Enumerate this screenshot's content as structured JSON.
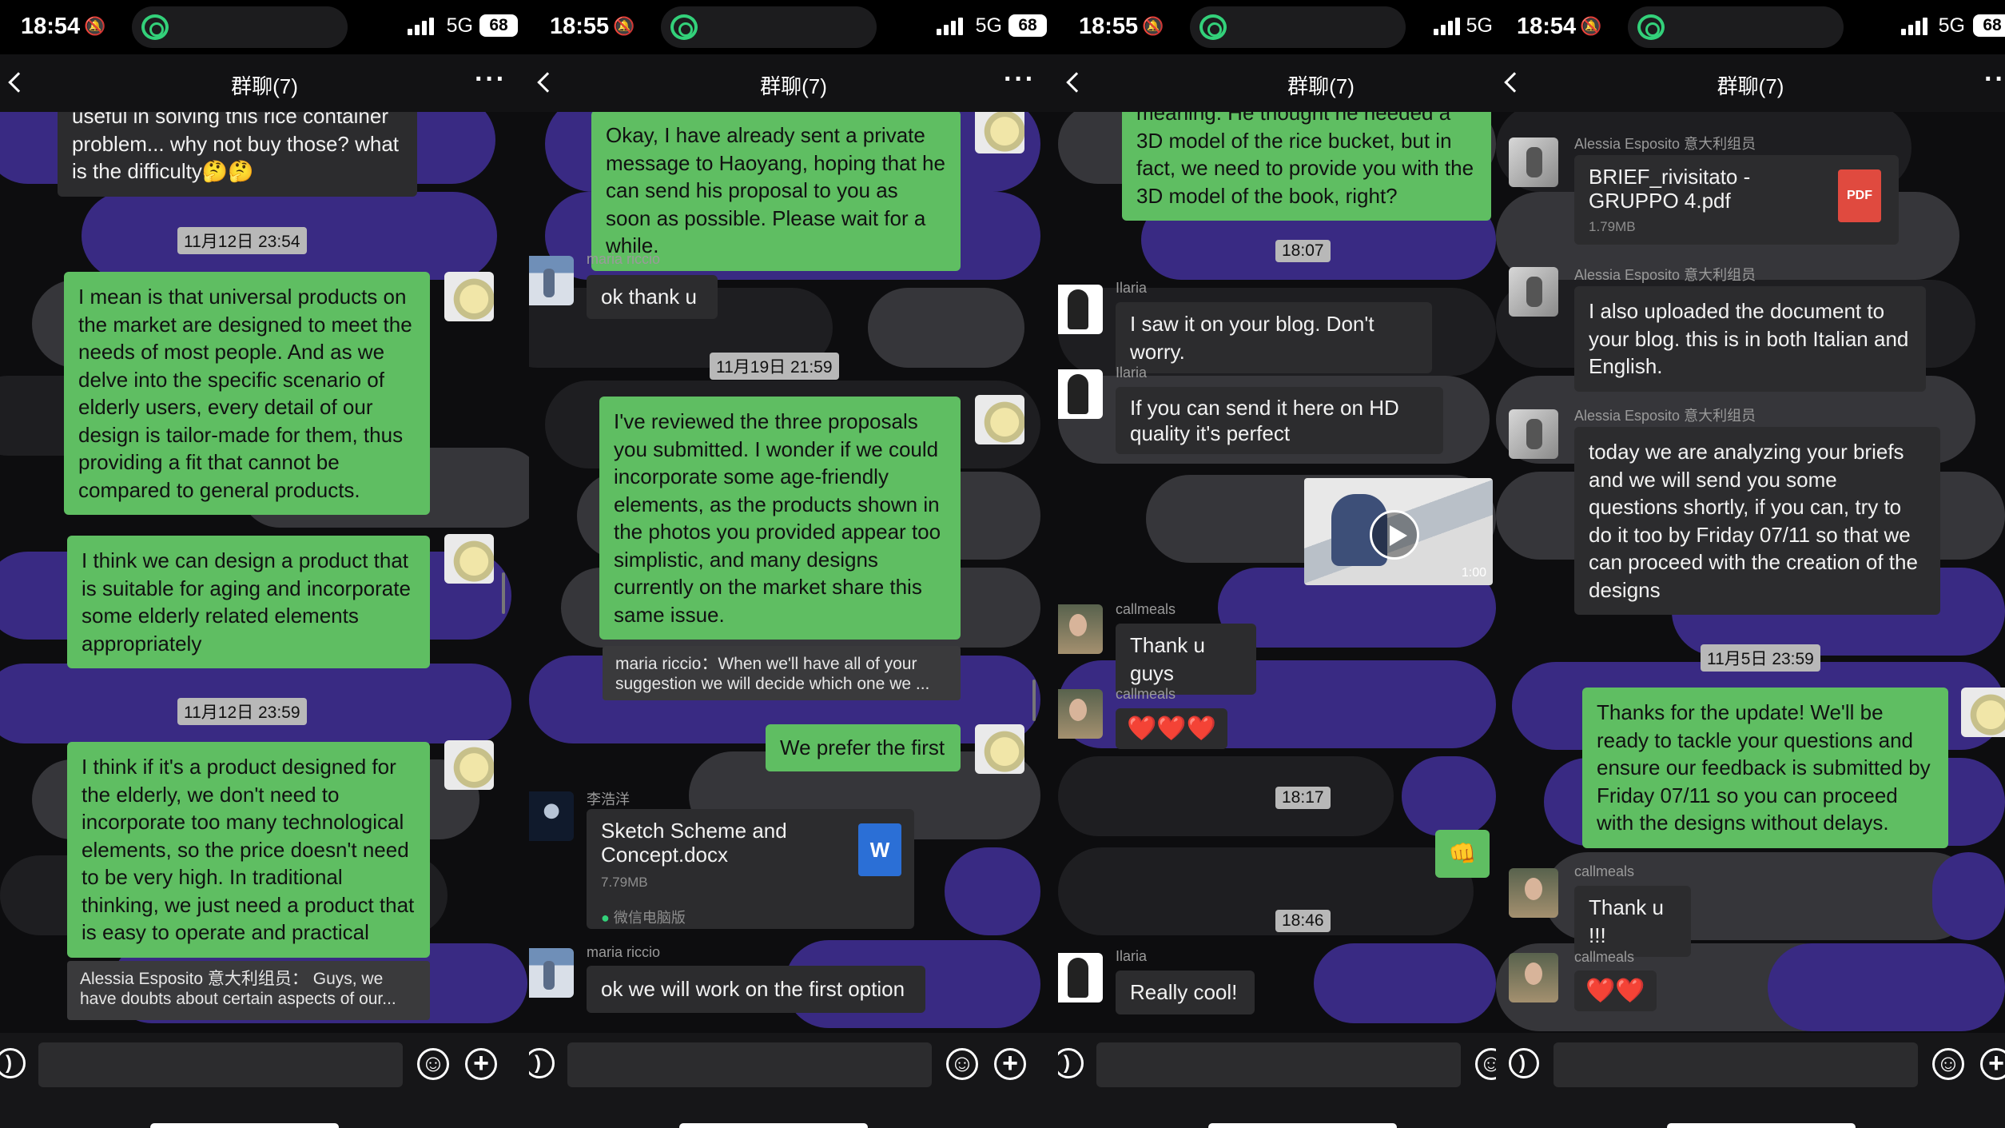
{
  "common": {
    "title": "群聊(7)",
    "network": "5G",
    "battery": "68"
  },
  "panel1": {
    "time": "18:54",
    "msgs": {
      "m0": "useful in solving this rice container problem... why not buy those? what is the difficulty🤔🤔",
      "ts1": "11月12日 23:54",
      "m1": "I mean is that universal products on the market are designed to meet the needs of most people. And as we delve into the specific scenario of elderly users, every detail of our design is tailor-made for them, thus providing a fit that cannot be compared to general products.",
      "m2": "I think we can design a product that is suitable for aging and incorporate some elderly related elements appropriately",
      "ts2": "11月12日 23:59",
      "m3": "I think if it's a product designed for the elderly, we don't need to incorporate too many technological elements, so the price doesn't need to be very high. In traditional thinking, we just need a product that is easy to operate and practical",
      "quote": "Alessia Esposito 意大利组员： Guys, we have doubts about certain aspects of our..."
    }
  },
  "panel2": {
    "time": "18:55",
    "msgs": {
      "m0": "Okay, I have already sent a private message to Haoyang, hoping that he can send his proposal to you as soon as possible. Please wait for a while.",
      "sender1": "maria riccio",
      "m1": "ok thank u",
      "ts1": "11月19日 21:59",
      "m2": "I've reviewed the three proposals you submitted. I wonder if we could incorporate some age-friendly elements, as the products shown in the photos you provided appear too simplistic, and many designs currently on the market share this same issue.",
      "quote": "maria riccio：When we'll have all of your suggestion we will decide which one we ...",
      "m3": "We prefer the first",
      "sender2": "李浩洋",
      "file_name": "Sketch Scheme and Concept.docx",
      "file_size": "7.79MB",
      "file_icon": "W",
      "file_source": "微信电脑版",
      "sender3": "maria riccio",
      "m4": "ok we will work on the first option"
    }
  },
  "panel3": {
    "time": "18:55",
    "msgs": {
      "m0": "meaning. He thought he needed a 3D model of the rice bucket, but in fact, we need to provide you with the 3D model of the book, right?",
      "ts1": "18:07",
      "sender1": "Ilaria",
      "m1": "I saw it on your blog. Don't worry.",
      "sender2": "Ilaria",
      "m2": "If you can send it here on HD quality it's perfect",
      "video_duration": "1:00",
      "sender3": "callmeals",
      "m3": "Thank u guys",
      "sender4": "callmeals",
      "m4": "❤️❤️❤️",
      "ts2": "18:17",
      "m5": "👊",
      "ts3": "18:46",
      "sender5": "Ilaria",
      "m6": "Really cool!"
    }
  },
  "panel4": {
    "time": "18:54",
    "msgs": {
      "sender1": "Alessia Esposito 意大利组员",
      "file_name": "BRIEF_rivisitato - GRUPPO 4.pdf",
      "file_size": "1.79MB",
      "file_icon": "PDF",
      "sender2": "Alessia Esposito 意大利组员",
      "m1": "I also uploaded the document to your blog. this is in both Italian and English.",
      "sender3": "Alessia Esposito 意大利组员",
      "m2": "today we are analyzing your briefs and we will send you some questions shortly, if you can, try to do it too by Friday 07/11 so that we can proceed with the creation of the designs",
      "ts1": "11月5日 23:59",
      "m3": "Thanks for the update! We'll be ready to tackle your questions and ensure our feedback is submitted by Friday 07/11 so you can proceed with the designs without delays.",
      "sender4": "callmeals",
      "m4": "Thank u !!!",
      "sender5": "callmeals",
      "m5": "❤️❤️"
    }
  }
}
